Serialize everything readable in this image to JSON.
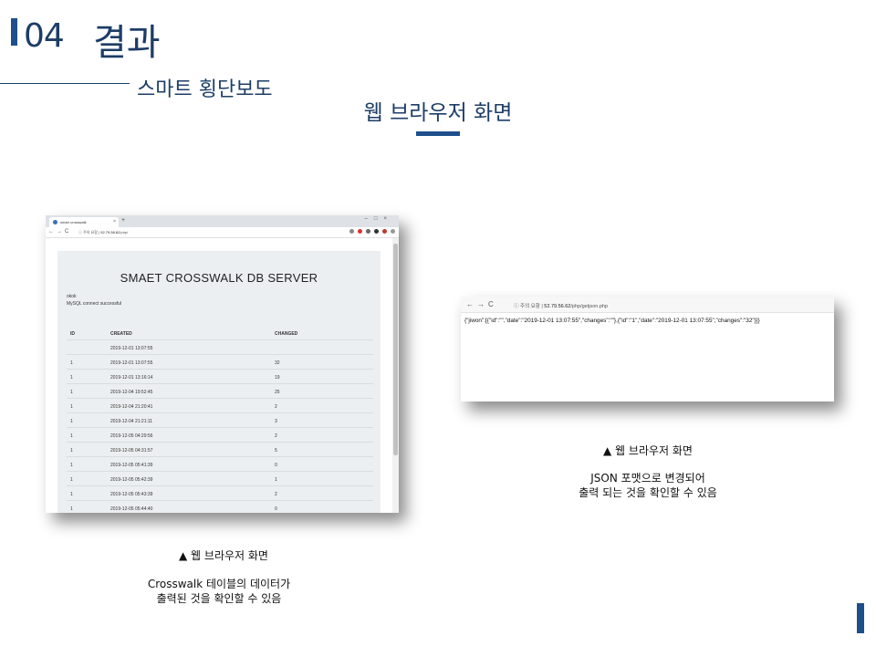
{
  "header": {
    "section_number": "04",
    "section_title": "결과",
    "subtitle": "스마트 횡단보도",
    "center_title": "웹 브라우저 화면"
  },
  "left_screenshot": {
    "tab_title": "smart crosswalk",
    "tab_close": "×",
    "new_tab": "+",
    "window_controls": "–□×",
    "nav_buttons": "←→C",
    "security_label": "ⓘ 주의 요함",
    "url_host": "52.79.56.62",
    "url_path": "/php/",
    "page_title": "SMAET CROSSWALK DB SERVER",
    "messages": [
      "okok",
      "MySQL connect successful"
    ],
    "table": {
      "headers": [
        "ID",
        "CREATED",
        "CHANGED"
      ],
      "rows": [
        {
          "id": "",
          "created": "2019-12-01 13:07:55",
          "changed": ""
        },
        {
          "id": "1",
          "created": "2019-12-01 13:07:55",
          "changed": "32"
        },
        {
          "id": "1",
          "created": "2019-12-01 13:16:14",
          "changed": "19"
        },
        {
          "id": "1",
          "created": "2019-12-04 19:52:45",
          "changed": "25"
        },
        {
          "id": "1",
          "created": "2019-12-04 21:20:41",
          "changed": "2"
        },
        {
          "id": "1",
          "created": "2019-12-04 21:21:11",
          "changed": "3"
        },
        {
          "id": "1",
          "created": "2019-12-05 04:29:56",
          "changed": "2"
        },
        {
          "id": "1",
          "created": "2019-12-05 04:31:57",
          "changed": "5"
        },
        {
          "id": "1",
          "created": "2019-12-05 05:41:39",
          "changed": "0"
        },
        {
          "id": "1",
          "created": "2019-12-05 05:42:39",
          "changed": "1"
        },
        {
          "id": "1",
          "created": "2019-12-05 05:43:39",
          "changed": "2"
        },
        {
          "id": "1",
          "created": "2019-12-05 05:44:40",
          "changed": "0"
        },
        {
          "id": "1",
          "created": "2019-12-05 05:45:40",
          "changed": "0"
        }
      ]
    }
  },
  "right_screenshot": {
    "nav_buttons": "←→C",
    "security_label": "ⓘ 주의 요함",
    "url_host": "52.79.56.62",
    "url_path": "/php/getjson.php",
    "json_text": "{\"jiwon\":[{\"id\":\"\",\"date\":\"2019-12-01 13:07:55\",\"changes\":\"\"},{\"id\":\"1\",\"date\":\"2019-12-01 13:07:55\",\"changes\":\"32\"}]}"
  },
  "captions": {
    "left_heading": "▲ 웹 브라우저 화면",
    "left_line1": "Crosswalk 테이블의 데이터가",
    "left_line2": "출력된 것을 확인할 수 있음",
    "right_heading": "▲ 웹 브라우저 화면",
    "right_line1": "JSON 포맷으로 변경되어",
    "right_line2": "출력 되는 것을 확인할 수 있음"
  },
  "colors": {
    "accent": "#1d4f8c",
    "heading_text": "#1d3d66"
  }
}
